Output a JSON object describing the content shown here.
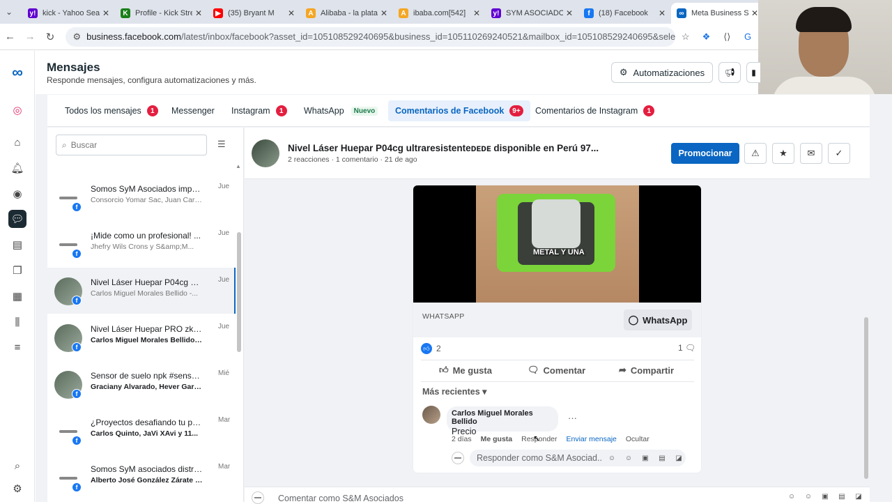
{
  "browser": {
    "tabs": [
      {
        "title": "kick - Yahoo Search",
        "fav": "y!",
        "color": "#6001d2"
      },
      {
        "title": "Profile - Kick Streaming",
        "fav": "K",
        "color": "#1a7f1a"
      },
      {
        "title": "(35) Bryant M",
        "fav": "▶",
        "color": "#ff0000"
      },
      {
        "title": "Alibaba - la plataforma",
        "fav": "A",
        "color": "#f5a623"
      },
      {
        "title": "ibaba.com[542]",
        "fav": "A",
        "color": "#f5a623"
      },
      {
        "title": "SYM ASOCIADOS",
        "fav": "y!",
        "color": "#6001d2"
      },
      {
        "title": "(18) Facebook",
        "fav": "f",
        "color": "#1877f2"
      },
      {
        "title": "Meta Business Suite",
        "fav": "∞",
        "color": "#0a66c2"
      }
    ],
    "url_host": "business.facebook.com",
    "url_path": "/latest/inbox/facebook?asset_id=105108529240695&business_id=105110269240521&mailbox_id=105108529240695&selected_item_i..."
  },
  "header": {
    "title": "Mensajes",
    "subtitle": "Responde mensajes, configura automatizaciones y más.",
    "automations_label": "Automatizaciones"
  },
  "msg_tabs": [
    {
      "label": "Todos los mensajes",
      "badge": "1"
    },
    {
      "label": "Messenger",
      "badge": ""
    },
    {
      "label": "Instagram",
      "badge": "1"
    },
    {
      "label": "WhatsApp",
      "tag": "Nuevo"
    },
    {
      "label": "Comentarios de Facebook",
      "badge": "9+"
    },
    {
      "label": "Comentarios de Instagram",
      "badge": "1"
    }
  ],
  "search": {
    "placeholder": "Buscar"
  },
  "conversations": [
    {
      "title": "Somos SyM Asociados impor...",
      "sub": "Consorcio Yomar Sac, Juan Carlos...",
      "date": "Jue"
    },
    {
      "title": "¡Mide como un profesional! ...",
      "sub": "Jhefry Wils Crons y S&amp;M...",
      "date": "Jue"
    },
    {
      "title": "Nivel Láser Huepar P04cg ultr...",
      "sub": "Carlos Miguel Morales Bellido -...",
      "date": "Jue"
    },
    {
      "title": "Nivel Láser Huepar PRO zk04...",
      "sub": "Carlos Miguel Morales Bellido -...",
      "date": "Jue"
    },
    {
      "title": "Sensor de suelo npk #sensor ...",
      "sub": "Graciany Alvarado, Hever Garcia...",
      "date": "Mié"
    },
    {
      "title": "¿Proyectos desafiando tu pre...",
      "sub": "Carlos Quinto, JaVi XAvi y 11...",
      "date": "Mar"
    },
    {
      "title": "Somos SyM asociados distrib...",
      "sub": "Alberto José González Zárate -...",
      "date": "Mar"
    }
  ],
  "detail": {
    "title": "Nivel Láser Huepar P04cg ultraresistenteᴅᴇᴅᴇ disponible en Perú 97...",
    "meta": "2 reacciones · 1 comentario · 21 de ago",
    "promote_label": "Promocionar",
    "video_caption": "METAL Y UNA",
    "wa_label": "WHATSAPP",
    "wa_button": "WhatsApp",
    "like_count": "2",
    "comment_count": "1",
    "like_action": "Me gusta",
    "comment_action": "Comentar",
    "share_action": "Compartir",
    "sort_label": "Más recientes",
    "comment": {
      "author": "Carlos Miguel Morales Bellido",
      "text": "Precio",
      "time": "2 días",
      "like": "Me gusta",
      "reply": "Responder",
      "send": "Enviar mensaje",
      "hide": "Ocultar"
    },
    "reply_placeholder": "Responder como S&M Asociad...",
    "bottom_placeholder": "Comentar como S&M Asociados"
  }
}
